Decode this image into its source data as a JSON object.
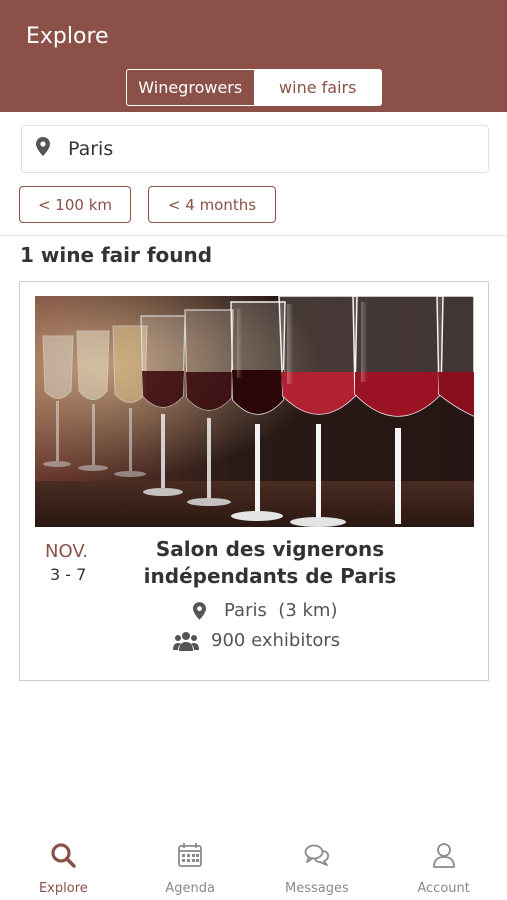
{
  "header": {
    "title": "Explore",
    "segments": [
      {
        "label": "Winegrowers",
        "active": false
      },
      {
        "label": "wine fairs",
        "active": true
      }
    ]
  },
  "search": {
    "icon": "location-pin-icon",
    "value": "Paris"
  },
  "filters": [
    {
      "label": "< 100 km"
    },
    {
      "label": "< 4 months"
    }
  ],
  "results": {
    "count_text": "1 wine fair found"
  },
  "event": {
    "image": "wine-glasses-photo",
    "month": "NOV.",
    "days": "3 - 7",
    "title_line1": "Salon des vignerons",
    "title_line2": "indépendants de Paris",
    "location": "Paris  (3 km)",
    "exhibitors": "900 exhibitors"
  },
  "tabbar": {
    "items": [
      {
        "label": "Explore",
        "icon": "search-icon",
        "active": true
      },
      {
        "label": "Agenda",
        "icon": "calendar-icon",
        "active": false
      },
      {
        "label": "Messages",
        "icon": "chat-bubbles-icon",
        "active": false
      },
      {
        "label": "Account",
        "icon": "user-icon",
        "active": false
      }
    ]
  },
  "colors": {
    "brand": "#8b5148",
    "text": "#333333",
    "muted": "#8a8a8a",
    "border": "#cfcfcf"
  }
}
